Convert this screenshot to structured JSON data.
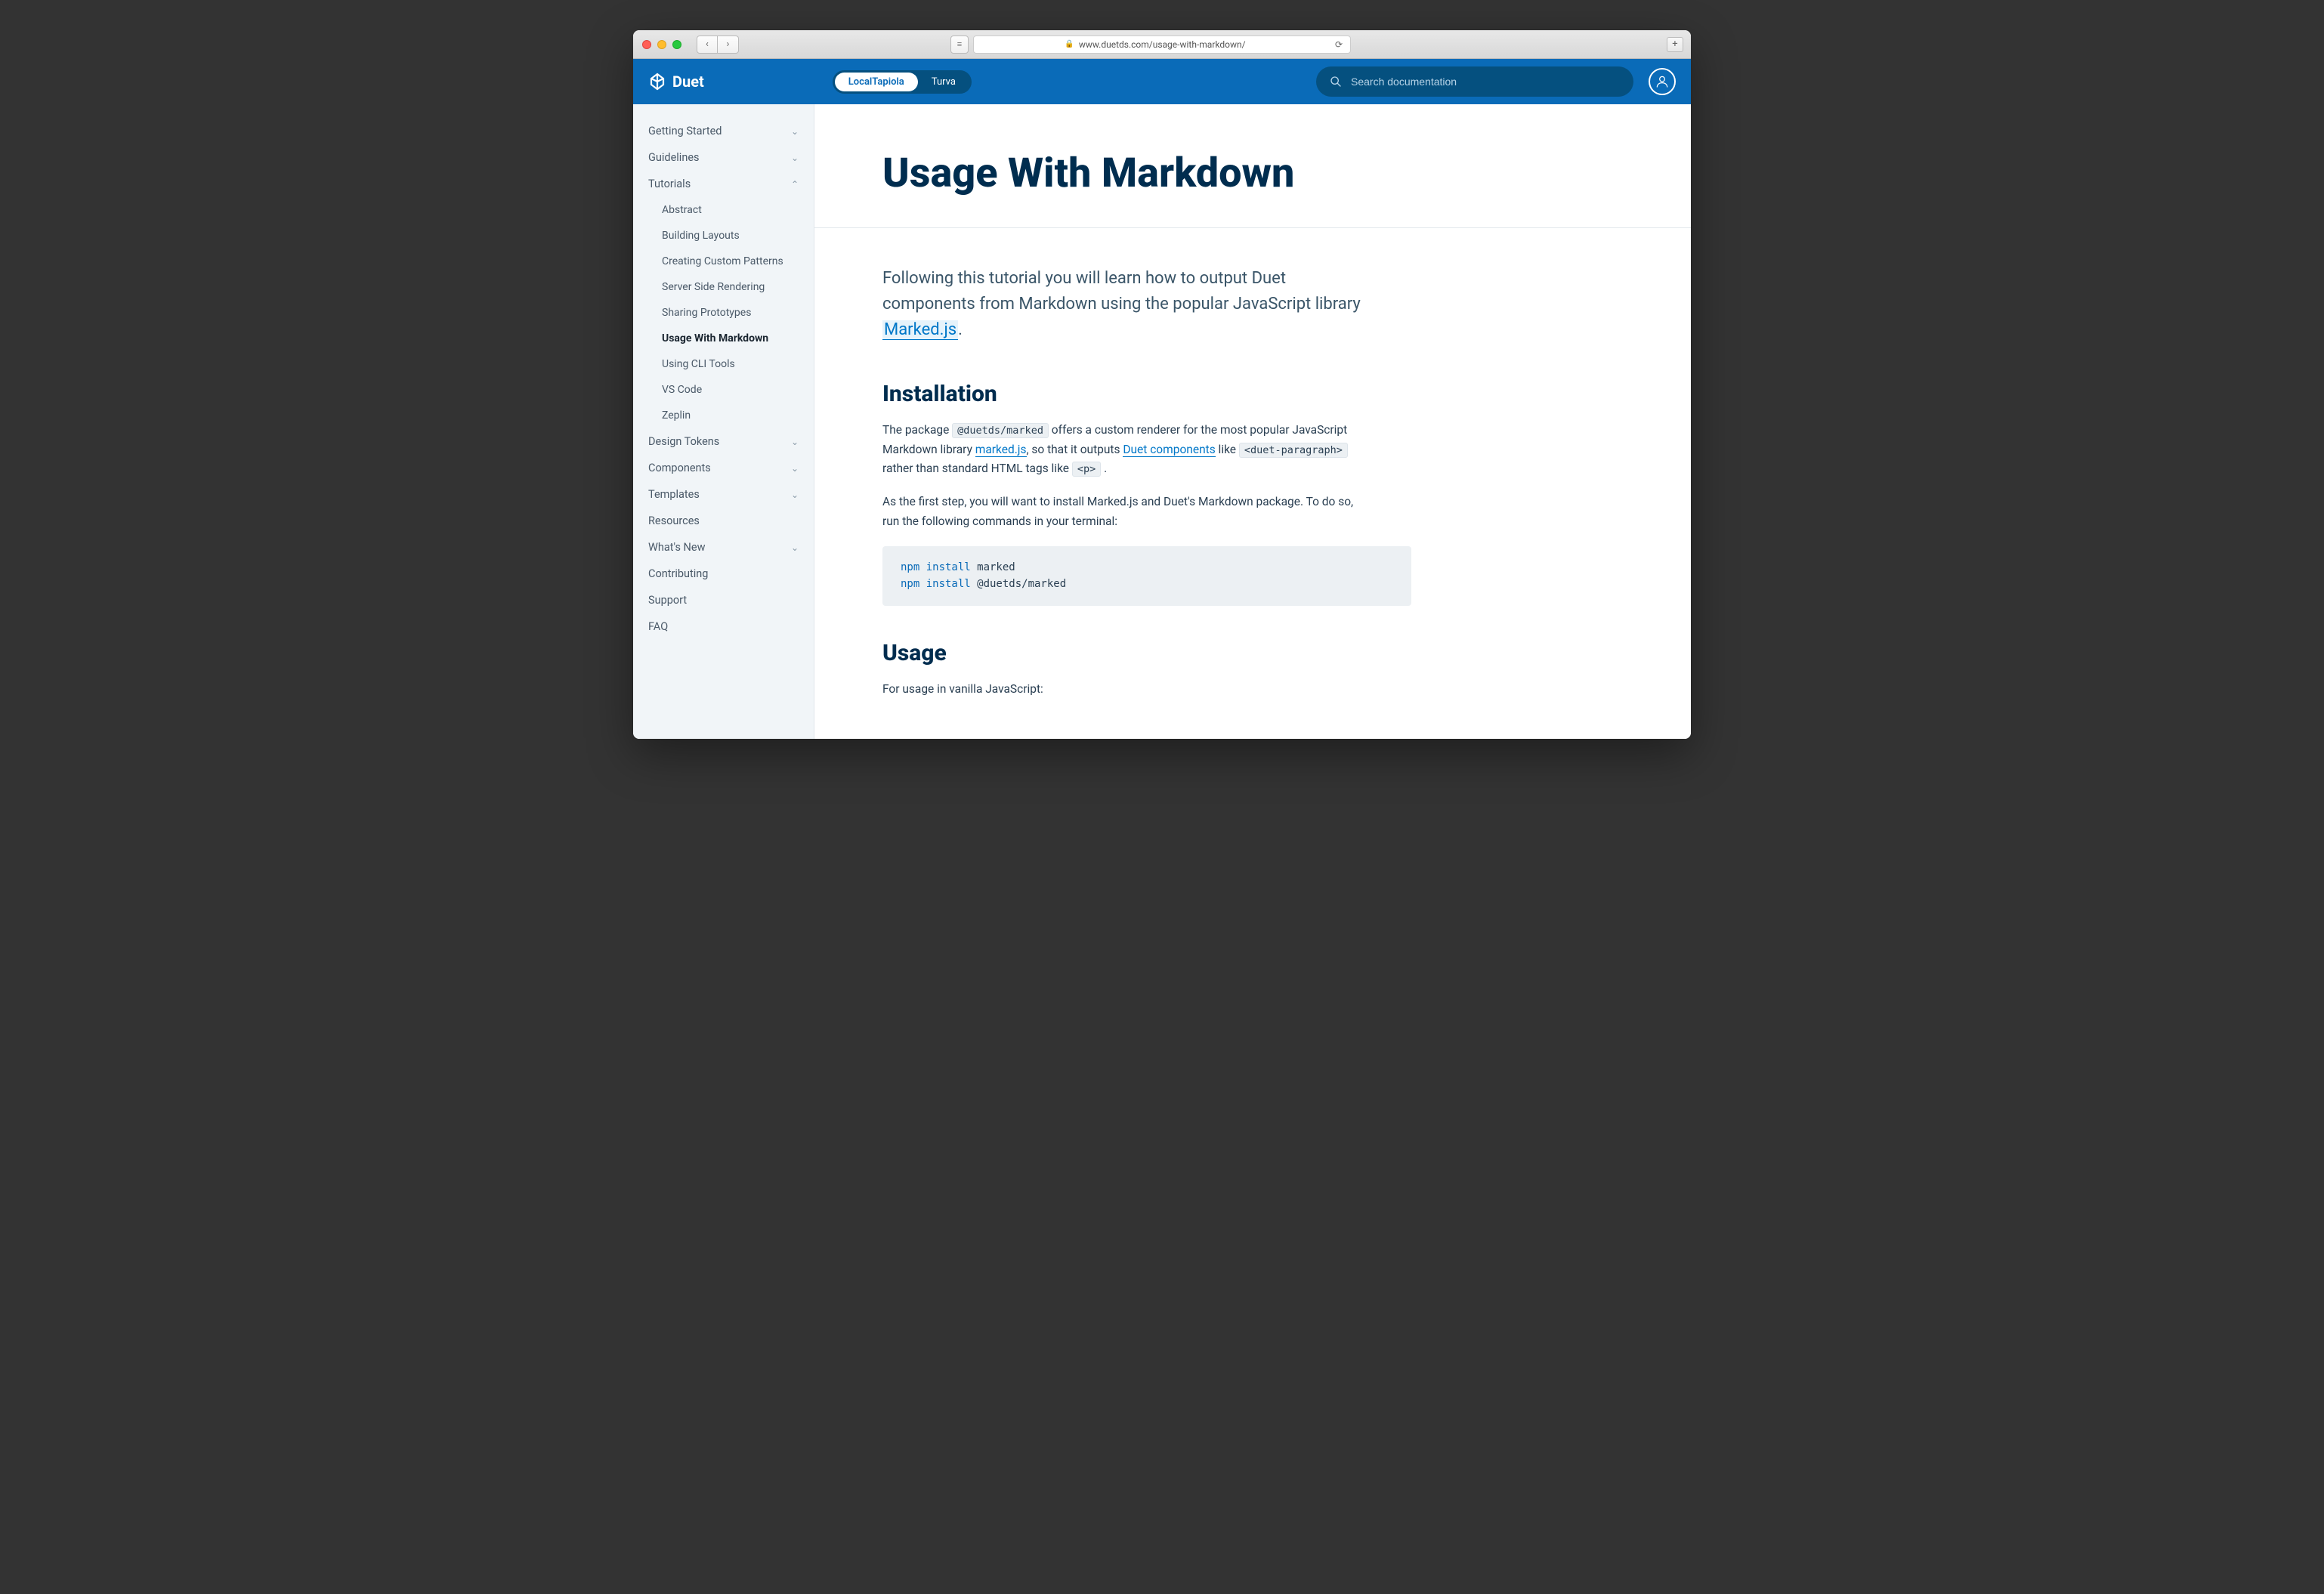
{
  "browser": {
    "url": "www.duetds.com/usage-with-markdown/"
  },
  "header": {
    "brand": "Duet",
    "toggle": {
      "opt1": "LocalTapiola",
      "opt2": "Turva"
    },
    "search_placeholder": "Search documentation"
  },
  "sidebar": {
    "items": [
      {
        "label": "Getting Started",
        "expandable": true,
        "expanded": false
      },
      {
        "label": "Guidelines",
        "expandable": true,
        "expanded": false
      },
      {
        "label": "Tutorials",
        "expandable": true,
        "expanded": true,
        "children": [
          {
            "label": "Abstract"
          },
          {
            "label": "Building Layouts"
          },
          {
            "label": "Creating Custom Patterns"
          },
          {
            "label": "Server Side Rendering"
          },
          {
            "label": "Sharing Prototypes"
          },
          {
            "label": "Usage With Markdown",
            "active": true
          },
          {
            "label": "Using CLI Tools"
          },
          {
            "label": "VS Code"
          },
          {
            "label": "Zeplin"
          }
        ]
      },
      {
        "label": "Design Tokens",
        "expandable": true,
        "expanded": false
      },
      {
        "label": "Components",
        "expandable": true,
        "expanded": false
      },
      {
        "label": "Templates",
        "expandable": true,
        "expanded": false
      },
      {
        "label": "Resources",
        "expandable": false
      },
      {
        "label": "What's New",
        "expandable": true,
        "expanded": false
      },
      {
        "label": "Contributing",
        "expandable": false
      },
      {
        "label": "Support",
        "expandable": false
      },
      {
        "label": "FAQ",
        "expandable": false
      }
    ]
  },
  "article": {
    "title": "Usage With Markdown",
    "intro_pre": "Following this tutorial you will learn how to output Duet components from Markdown using the popular JavaScript library ",
    "intro_link": "Marked.js",
    "intro_post": ".",
    "install": {
      "heading": "Installation",
      "p1_a": "The package ",
      "p1_code1": "@duetds/marked",
      "p1_b": " offers a custom renderer for the most popular JavaScript Markdown library ",
      "p1_link1": "marked.js",
      "p1_c": ", so that it outputs ",
      "p1_link2": "Duet components",
      "p1_d": " like ",
      "p1_code2": "<duet-paragraph>",
      "p1_e": " rather than standard HTML tags like ",
      "p1_code3": "<p>",
      "p1_f": " .",
      "p2": "As the first step, you will want to install Marked.js and Duet's Markdown package. To do so, run the following commands in your terminal:",
      "code_cmd": "npm install",
      "code_arg1": " marked",
      "code_arg2": " @duetds/marked"
    },
    "usage": {
      "heading": "Usage",
      "p1": "For usage in vanilla JavaScript:"
    }
  }
}
